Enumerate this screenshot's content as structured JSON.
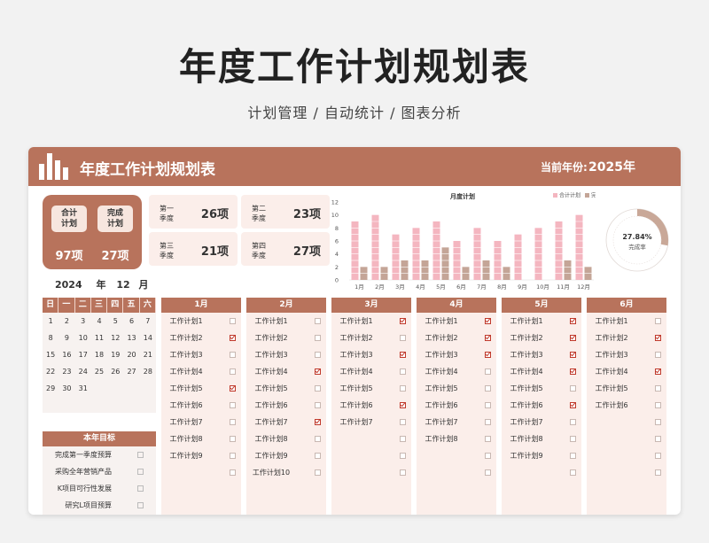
{
  "page": {
    "title": "年度工作计划规划表",
    "subtitle": "计划管理 / 自动统计 / 图表分析"
  },
  "header": {
    "title": "年度工作计划规划表",
    "year_label": "当前年份:",
    "year": "2025年"
  },
  "summary": {
    "total_label_1": "合计",
    "total_label_2": "计划",
    "total_value": "97项",
    "done_label_1": "完成",
    "done_label_2": "计划",
    "done_value": "27项"
  },
  "quarters": [
    {
      "l1": "第一",
      "l2": "季度",
      "value": "26项"
    },
    {
      "l1": "第二",
      "l2": "季度",
      "value": "23项"
    },
    {
      "l1": "第三",
      "l2": "季度",
      "value": "21项"
    },
    {
      "l1": "第四",
      "l2": "季度",
      "value": "27项"
    }
  ],
  "chart_data": {
    "type": "bar",
    "title": "月度计划",
    "categories": [
      "1月",
      "2月",
      "3月",
      "4月",
      "5月",
      "6月",
      "7月",
      "8月",
      "9月",
      "10月",
      "11月",
      "12月"
    ],
    "series": [
      {
        "name": "合计计划",
        "values": [
          9,
          10,
          7,
          8,
          9,
          6,
          8,
          6,
          7,
          8,
          9,
          10
        ],
        "color": "#f4b6c0"
      },
      {
        "name": "完成计划",
        "values": [
          2,
          2,
          3,
          3,
          5,
          2,
          3,
          2,
          0,
          0,
          3,
          2
        ],
        "color": "#c4a597"
      }
    ],
    "ylim": [
      0,
      12
    ],
    "yticks": [
      0,
      2,
      4,
      6,
      8,
      10,
      12
    ],
    "legend": "top-right",
    "grid": false
  },
  "donut": {
    "value": 0.2784,
    "value_text": "27.84%",
    "label": "完成率",
    "fill_color": "#c9a898",
    "track_color": "#ffffff"
  },
  "calendar": {
    "year": "2024",
    "year_suffix": "年",
    "month": "12",
    "month_suffix": "月",
    "weekdays": [
      "日",
      "一",
      "二",
      "三",
      "四",
      "五",
      "六"
    ],
    "days": [
      "1",
      "2",
      "3",
      "4",
      "5",
      "6",
      "7",
      "8",
      "9",
      "10",
      "11",
      "12",
      "13",
      "14",
      "15",
      "16",
      "17",
      "18",
      "19",
      "20",
      "21",
      "22",
      "23",
      "24",
      "25",
      "26",
      "27",
      "28",
      "29",
      "30",
      "31"
    ]
  },
  "goals": {
    "title": "本年目标",
    "items": [
      "完成第一季度预算",
      "采购全年营销产品",
      "K项目可行性发展",
      "研究L项目预算"
    ]
  },
  "months": [
    {
      "name": "1月",
      "tasks": [
        {
          "label": "工作计划1",
          "done": false
        },
        {
          "label": "工作计划2",
          "done": true
        },
        {
          "label": "工作计划3",
          "done": false
        },
        {
          "label": "工作计划4",
          "done": false
        },
        {
          "label": "工作计划5",
          "done": true
        },
        {
          "label": "工作计划6",
          "done": false
        },
        {
          "label": "工作计划7",
          "done": false
        },
        {
          "label": "工作计划8",
          "done": false
        },
        {
          "label": "工作计划9",
          "done": false
        },
        {
          "label": "",
          "done": false
        }
      ]
    },
    {
      "name": "2月",
      "tasks": [
        {
          "label": "工作计划1",
          "done": false
        },
        {
          "label": "工作计划2",
          "done": false
        },
        {
          "label": "工作计划3",
          "done": false
        },
        {
          "label": "工作计划4",
          "done": true
        },
        {
          "label": "工作计划5",
          "done": false
        },
        {
          "label": "工作计划6",
          "done": false
        },
        {
          "label": "工作计划7",
          "done": true
        },
        {
          "label": "工作计划8",
          "done": false
        },
        {
          "label": "工作计划9",
          "done": false
        },
        {
          "label": "工作计划10",
          "done": false
        }
      ]
    },
    {
      "name": "3月",
      "tasks": [
        {
          "label": "工作计划1",
          "done": true
        },
        {
          "label": "工作计划2",
          "done": false
        },
        {
          "label": "工作计划3",
          "done": true
        },
        {
          "label": "工作计划4",
          "done": false
        },
        {
          "label": "工作计划5",
          "done": false
        },
        {
          "label": "工作计划6",
          "done": true
        },
        {
          "label": "工作计划7",
          "done": false
        }
      ]
    },
    {
      "name": "4月",
      "tasks": [
        {
          "label": "工作计划1",
          "done": true
        },
        {
          "label": "工作计划2",
          "done": true
        },
        {
          "label": "工作计划3",
          "done": true
        },
        {
          "label": "工作计划4",
          "done": false
        },
        {
          "label": "工作计划5",
          "done": false
        },
        {
          "label": "工作计划6",
          "done": false
        },
        {
          "label": "工作计划7",
          "done": false
        },
        {
          "label": "工作计划8",
          "done": false
        }
      ]
    },
    {
      "name": "5月",
      "tasks": [
        {
          "label": "工作计划1",
          "done": true
        },
        {
          "label": "工作计划2",
          "done": true
        },
        {
          "label": "工作计划3",
          "done": true
        },
        {
          "label": "工作计划4",
          "done": true
        },
        {
          "label": "工作计划5",
          "done": false
        },
        {
          "label": "工作计划6",
          "done": true
        },
        {
          "label": "工作计划7",
          "done": false
        },
        {
          "label": "工作计划8",
          "done": false
        },
        {
          "label": "工作计划9",
          "done": false
        }
      ]
    },
    {
      "name": "6月",
      "tasks": [
        {
          "label": "工作计划1",
          "done": false
        },
        {
          "label": "工作计划2",
          "done": true
        },
        {
          "label": "工作计划3",
          "done": false
        },
        {
          "label": "工作计划4",
          "done": true
        },
        {
          "label": "工作计划5",
          "done": false
        },
        {
          "label": "工作计划6",
          "done": false
        }
      ]
    }
  ]
}
